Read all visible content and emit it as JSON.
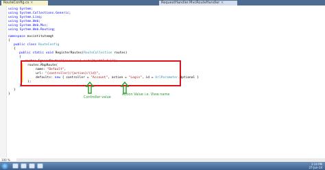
{
  "tabs": [
    {
      "label": "RouteConfig.cs",
      "close": "×"
    },
    {
      "label": "RequestHandler.MvcRouteHandler",
      "close": "×"
    }
  ],
  "code": {
    "line1": "using System;",
    "line2": "using System.Collections.Generic;",
    "line3": "using System.Linq;",
    "line4": "using System.Web;",
    "line5": "using System.Web.Mvc;",
    "line6": "using System.Web.Routing;",
    "ns_kw": "namespace",
    "ns_name": " mvcintitutemgt",
    "class_mod": "public class",
    "class_name": " RouteConfig",
    "m_mod": "public static void",
    "m_name": " RegisterRoutes(",
    "m_type": "RouteCollection",
    "m_rest": " routes)",
    "ignore_a": "routes.IgnoreRoute(",
    "ignore_str": "\"{resource}.axd/{*pathInfo}\"",
    "ignore_b": ");",
    "map1": "routes.MapRoute(",
    "name_a": "name: ",
    "name_str": "\"Default\"",
    "name_b": ",",
    "url_a": "url: ",
    "url_str": "\"{controller}/{action}/{id}\"",
    "url_b": ",",
    "def_a": "defaults: ",
    "def_new": "new",
    "def_b": " { controller = ",
    "def_ctrl": "\"Account\"",
    "def_c": ", action = ",
    "def_act": "\"Login\"",
    "def_d": ", id = ",
    "def_url": "UrlParameter",
    "def_e": ".Optional }",
    "close_paren": ");",
    "ob1": "{",
    "ob2": "{",
    "ob3": "{",
    "cb1": "}",
    "cb2": "}",
    "cb3": "}"
  },
  "annotations": {
    "controller": "Controller value",
    "action": "Action Value i.e. View name"
  },
  "status": {
    "zoom": "100 %"
  },
  "tray": {
    "time": "1:14 PM",
    "date": "27-Jun-14"
  },
  "colors": {
    "highlight": "#e0101a",
    "arrow": "#2b9a2b"
  }
}
